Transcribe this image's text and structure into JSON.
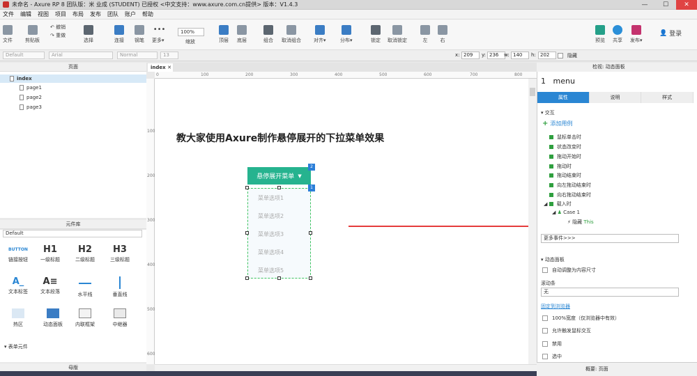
{
  "window": {
    "title": "未命名 - Axure RP 8 团队版：米 业成 (STUDENT) 已授权 <中文支持：www.axure.com.cn提供> 版本：V1.4.3",
    "controls": [
      "—",
      "☐",
      "✕"
    ]
  },
  "menu": [
    "文件",
    "编辑",
    "视图",
    "项目",
    "布局",
    "发布",
    "团队",
    "账户",
    "帮助"
  ],
  "toolbar": {
    "file": "文件",
    "clipboard": "剪贴板",
    "undo": "撤销",
    "redo": "重做",
    "select": "选择",
    "connect": "连接",
    "pen": "钢笔",
    "more": "更多▾",
    "zoom": "100%",
    "zoom_label": "缩放",
    "top": "顶层",
    "bottom": "底层",
    "group": "组合",
    "ungroup": "取消组合",
    "align": "对齐▾",
    "distribute": "分布▾",
    "lock": "锁定",
    "unlock": "取消锁定",
    "left": "左",
    "right": "右",
    "preview": "预览",
    "share": "共享",
    "publish": "发布▾",
    "login": "登录"
  },
  "format": {
    "style": "Default",
    "font": "Arial",
    "weight": "Normal",
    "size": "13",
    "x_label": "x:",
    "x": "209",
    "y_label": "y:",
    "y": "236",
    "w_label": "w:",
    "w": "140",
    "h_label": "h:",
    "h": "202",
    "hidden": "隐藏"
  },
  "pages": {
    "header": "页面",
    "items": [
      "index",
      "page1",
      "page2",
      "page3"
    ]
  },
  "library": {
    "header": "元件库",
    "selected": "Default",
    "items": [
      {
        "glyph": "BUTTON",
        "label": "链接按钮"
      },
      {
        "glyph": "H1",
        "label": "一级标题"
      },
      {
        "glyph": "H2",
        "label": "二级标题"
      },
      {
        "glyph": "H3",
        "label": "三级标题"
      },
      {
        "glyph": "A_",
        "label": "文本标签"
      },
      {
        "glyph": "A≡",
        "label": "文本段落"
      },
      {
        "glyph": "",
        "label": "水平线"
      },
      {
        "glyph": "",
        "label": "垂直线"
      },
      {
        "glyph": "",
        "label": "热区"
      },
      {
        "glyph": "",
        "label": "动态面板"
      },
      {
        "glyph": "",
        "label": "内联框架"
      },
      {
        "glyph": "",
        "label": "中继器"
      }
    ],
    "section": "表单元件",
    "masters": "母版"
  },
  "canvas": {
    "tab": "index",
    "ruler_h": [
      "0",
      "100",
      "200",
      "300",
      "400",
      "500",
      "600",
      "700",
      "800"
    ],
    "ruler_v": [
      "100",
      "200",
      "300",
      "400",
      "500",
      "600"
    ],
    "headline": "教大家使用Axure制作悬停展开的下拉菜单效果",
    "dropdown_label": "悬停展开菜单",
    "menu_items": [
      "菜单选项1",
      "菜单选项2",
      "菜单选项3",
      "菜单选项4",
      "菜单选项5"
    ],
    "badge_button": "2",
    "badge_menu": "1"
  },
  "inspector": {
    "header": "检视: 动态面板",
    "widget_badge": "1",
    "widget_name": "menu",
    "tabs": [
      "属性",
      "说明",
      "样式"
    ],
    "interaction_title": "交互",
    "add_case": "添加用例",
    "events": [
      "鼠标单击时",
      "状态改变时",
      "拖动开始时",
      "拖动时",
      "拖动结束时",
      "向左拖动结束时",
      "向右拖动结束时"
    ],
    "onload": "载入时",
    "case": "Case 1",
    "action": "隐藏",
    "action_target": "This",
    "more_events": "更多事件>>>",
    "panel_title": "动态面板",
    "auto_fit": "自动调整为内容尺寸",
    "scrollbar_label": "滚动条",
    "scrollbar_value": "无",
    "pin": "固定到浏览器",
    "fit_width": "100%宽度（仅浏览器中有效）",
    "allow_trigger": "允许触发鼠标交互",
    "disabled": "禁用",
    "selected": "选中",
    "status_left": "概要: 页面"
  }
}
